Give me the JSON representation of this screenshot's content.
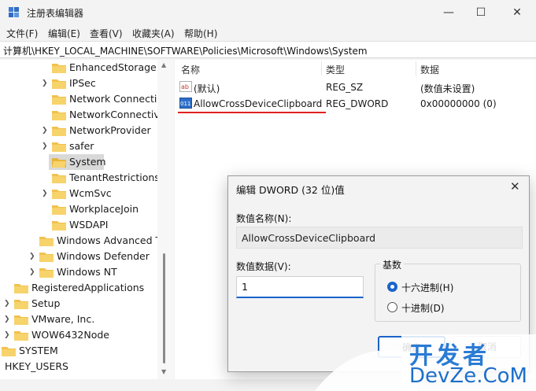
{
  "window": {
    "title": "注册表编辑器",
    "minimize": "—",
    "maximize": "☐",
    "close": "✕"
  },
  "menu": [
    {
      "label": "文件(F)"
    },
    {
      "label": "编辑(E)"
    },
    {
      "label": "查看(V)"
    },
    {
      "label": "收藏夹(A)"
    },
    {
      "label": "帮助(H)"
    }
  ],
  "address": "计算机\\HKEY_LOCAL_MACHINE\\SOFTWARE\\Policies\\Microsoft\\Windows\\System",
  "tree": [
    {
      "label": "EnhancedStorageD"
    },
    {
      "label": "IPSec"
    },
    {
      "label": "Network Connectio"
    },
    {
      "label": "NetworkConnectivit"
    },
    {
      "label": "NetworkProvider"
    },
    {
      "label": "safer"
    },
    {
      "label": "System"
    },
    {
      "label": "TenantRestrictions"
    },
    {
      "label": "WcmSvc"
    },
    {
      "label": "WorkplaceJoin"
    },
    {
      "label": "WSDAPI"
    },
    {
      "label": "Windows Advanced Th"
    },
    {
      "label": "Windows Defender"
    },
    {
      "label": "Windows NT"
    },
    {
      "label": "RegisteredApplications"
    },
    {
      "label": "Setup"
    },
    {
      "label": "VMware, Inc."
    },
    {
      "label": "WOW6432Node"
    },
    {
      "label": "SYSTEM"
    },
    {
      "label": "HKEY_USERS"
    }
  ],
  "list": {
    "headers": {
      "name": "名称",
      "type": "类型",
      "data": "数据"
    },
    "rows": [
      {
        "icon": "ab",
        "name": "(默认)",
        "type": "REG_SZ",
        "data": "(数值未设置)"
      },
      {
        "icon": "011",
        "name": "AllowCrossDeviceClipboard",
        "type": "REG_DWORD",
        "data": "0x00000000 (0)"
      }
    ]
  },
  "dialog": {
    "title": "编辑 DWORD (32 位)值",
    "close": "✕",
    "name_label": "数值名称(N):",
    "name_value": "AllowCrossDeviceClipboard",
    "data_label": "数值数据(V):",
    "data_value": "1",
    "base_label": "基数",
    "hex_label": "十六进制(H)",
    "dec_label": "十进制(D)",
    "ok_label": "确定",
    "cancel_label": "取消"
  },
  "watermark": {
    "chars": "开发者",
    "text": "DevZe.CoM"
  },
  "colors": {
    "accent": "#1a63c9",
    "folder": "#f2c14e",
    "highlight_underline": "#e02020"
  }
}
